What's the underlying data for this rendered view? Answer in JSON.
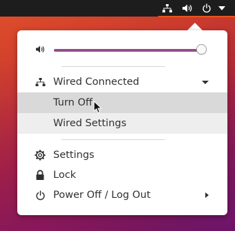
{
  "topbar": {
    "icons": [
      "network-wired-icon",
      "volume-icon",
      "power-icon",
      "menu-arrow-icon"
    ]
  },
  "volume": {
    "icon": "speaker-icon",
    "level": 0.99
  },
  "network": {
    "label": "Wired Connected",
    "icon": "network-wired-icon",
    "submenu": [
      {
        "label": "Turn Off"
      },
      {
        "label": "Wired Settings"
      }
    ]
  },
  "items": [
    {
      "label": "Settings",
      "icon": "gear-icon"
    },
    {
      "label": "Lock",
      "icon": "lock-icon"
    },
    {
      "label": "Power Off / Log Out",
      "icon": "power-icon"
    }
  ],
  "colors": {
    "accent": "#924d8b",
    "topbar_indicator": "#e95420",
    "hover_row": "#d9d9d9",
    "submenu_row": "#eeeeee"
  }
}
